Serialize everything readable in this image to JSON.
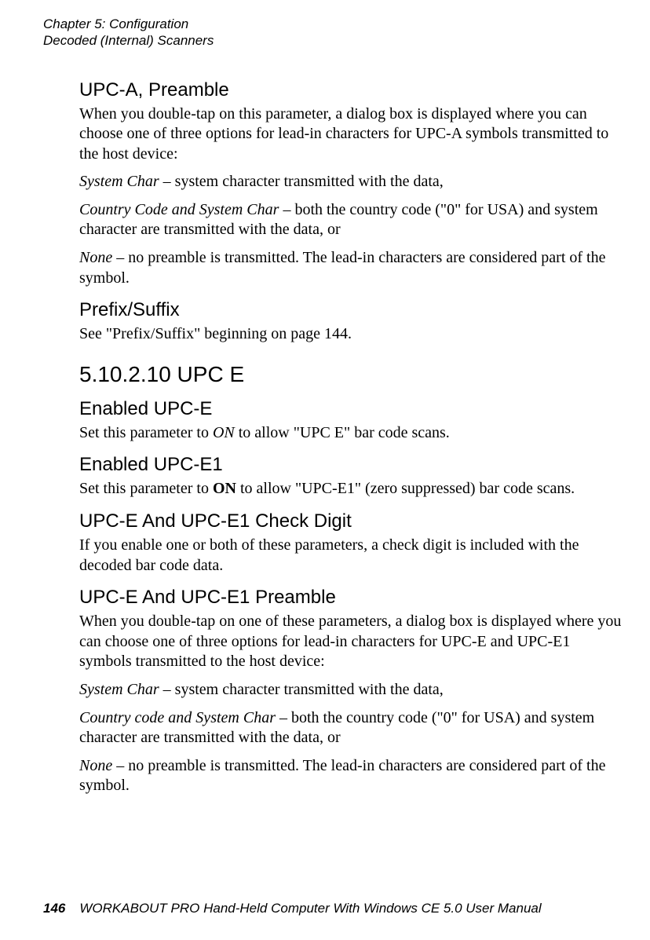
{
  "header": {
    "line1": "Chapter 5: Configuration",
    "line2": "Decoded (Internal) Scanners"
  },
  "sections": {
    "upc_a_preamble": {
      "title": "UPC-A, Preamble",
      "p1": "When you double-tap on this parameter, a dialog box is displayed where you can choose one of three options for lead-in characters for UPC-A symbols transmitted to the host device:",
      "p2_lead": "System Char",
      "p2_rest": " – system character transmitted with the data,",
      "p3_lead": "Country Code and System Char",
      "p3_rest": " – both the country code (\"0\" for USA) and system character are transmitted with the data, or",
      "p4_lead": "None",
      "p4_rest": " – no preamble is transmitted. The lead-in characters are considered part of the symbol."
    },
    "prefix_suffix": {
      "title": "Prefix/Suffix",
      "p1": "See \"Prefix/Suffix\" beginning on page 144."
    },
    "upc_e_section": {
      "title": "5.10.2.10  UPC E"
    },
    "enabled_upc_e": {
      "title": "Enabled UPC-E",
      "p1_a": "Set this parameter to ",
      "p1_em": "ON",
      "p1_b": " to allow \"UPC E\" bar code scans."
    },
    "enabled_upc_e1": {
      "title": "Enabled UPC-E1",
      "p1_a": "Set this parameter to ",
      "p1_strong": "ON",
      "p1_b": " to allow \"UPC-E1\" (zero suppressed) bar code scans."
    },
    "upc_e_check_digit": {
      "title": "UPC-E And UPC-E1 Check Digit",
      "p1": "If you enable one or both of these parameters, a check digit is included with the decoded bar code data."
    },
    "upc_e_preamble": {
      "title": "UPC-E And UPC-E1 Preamble",
      "p1": "When you double-tap on one of these parameters, a dialog box is displayed where you can choose one of three options for lead-in characters for UPC-E and UPC-E1 symbols transmitted to the host device:",
      "p2_lead": "System Char",
      "p2_rest": " – system character transmitted with the data,",
      "p3_lead": "Country code and System Char",
      "p3_rest": " – both the country code (\"0\" for USA) and system character are transmitted with the data, or",
      "p4_lead": "None",
      "p4_rest": " – no preamble is transmitted. The lead-in characters are considered part of the symbol."
    }
  },
  "footer": {
    "page": "146",
    "text": "WORKABOUT PRO Hand-Held Computer With Windows CE 5.0 User Manual"
  }
}
